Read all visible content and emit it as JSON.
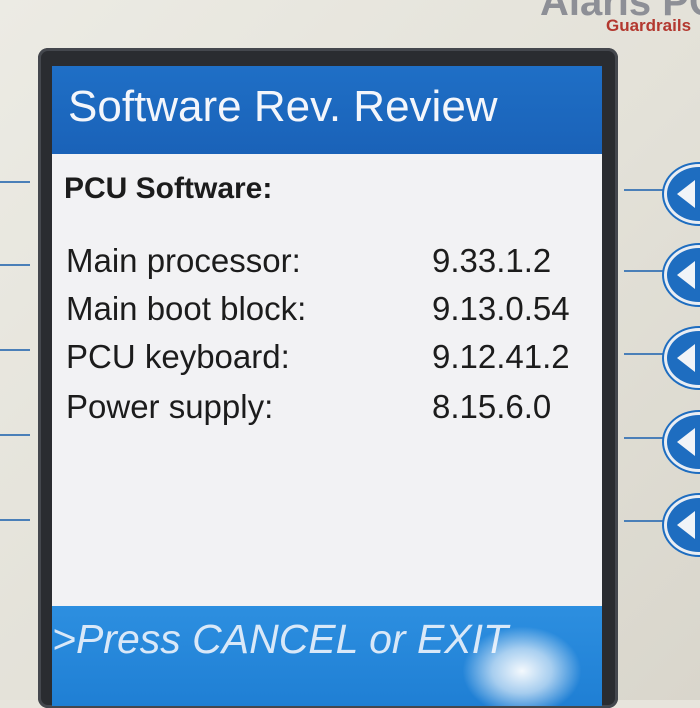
{
  "device": {
    "brand": "Alaris PC",
    "brand_sub": "Guardrails"
  },
  "screen": {
    "title": "Software Rev. Review",
    "section_label": "PCU Software:",
    "rows": [
      {
        "label": "Main processor:",
        "value": "9.33.1.2"
      },
      {
        "label": "Main boot block:",
        "value": "9.13.0.54"
      },
      {
        "label": "PCU keyboard:",
        "value": "9.12.41.2"
      },
      {
        "label": "Power supply:",
        "value": "8.15.6.0"
      }
    ],
    "footer": ">Press CANCEL or EXIT"
  },
  "softkeys": [
    {
      "icon": "left-arrow-icon"
    },
    {
      "icon": "left-arrow-icon"
    },
    {
      "icon": "left-arrow-icon"
    },
    {
      "icon": "left-arrow-icon"
    },
    {
      "icon": "left-arrow-icon"
    }
  ],
  "colors": {
    "title_bar": "#1f6fc6",
    "footer_bar": "#2d8fe0",
    "brand_sub": "#b3382f"
  }
}
